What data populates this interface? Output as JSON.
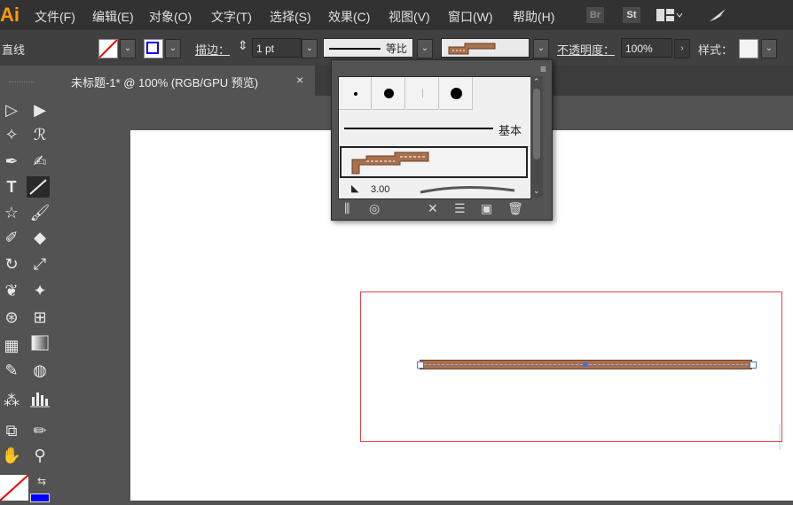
{
  "app": {
    "logo": "Ai"
  },
  "menu": [
    "文件(F)",
    "编辑(E)",
    "对象(O)",
    "文字(T)",
    "选择(S)",
    "效果(C)",
    "视图(V)",
    "窗口(W)",
    "帮助(H)"
  ],
  "menubar_icons": {
    "bridge": "Br",
    "stock": "St"
  },
  "control_bar": {
    "object_type": "直线",
    "stroke_label": "描边：",
    "stroke_weight": "1 pt",
    "profile_label": "等比",
    "opacity_label": "不透明度：",
    "opacity_value": "100%",
    "style_label": "样式：",
    "stroke_color": "#0000ff"
  },
  "document_tab": {
    "title": "未标题-1* @ 100% (RGB/GPU 预览)",
    "close": "×"
  },
  "brushes_panel": {
    "basic_label": "基本",
    "next_brush_label": "3.00",
    "menu_icon": "≡"
  },
  "colors": {
    "accent_logo": "#ff9a00",
    "selection_box": "#e0454b",
    "pattern_brush": "#a8704d",
    "handle": "#4a6fd6"
  },
  "icons": [
    "selection-icon",
    "direct-selection-icon",
    "magic-wand-icon",
    "lasso-icon",
    "pen-icon",
    "curvature-icon",
    "type-icon",
    "line-icon",
    "shape-icon",
    "paintbrush-icon",
    "shaper-icon",
    "eraser-icon",
    "rotate-icon",
    "scale-icon",
    "warp-icon",
    "puppet-warp-icon",
    "shape-builder-icon",
    "perspective-icon",
    "mesh-icon",
    "gradient-icon",
    "eyedropper-icon",
    "blend-icon",
    "symbol-sprayer-icon",
    "column-graph-icon",
    "artboard-icon",
    "slice-icon",
    "hand-icon",
    "zoom-icon"
  ]
}
